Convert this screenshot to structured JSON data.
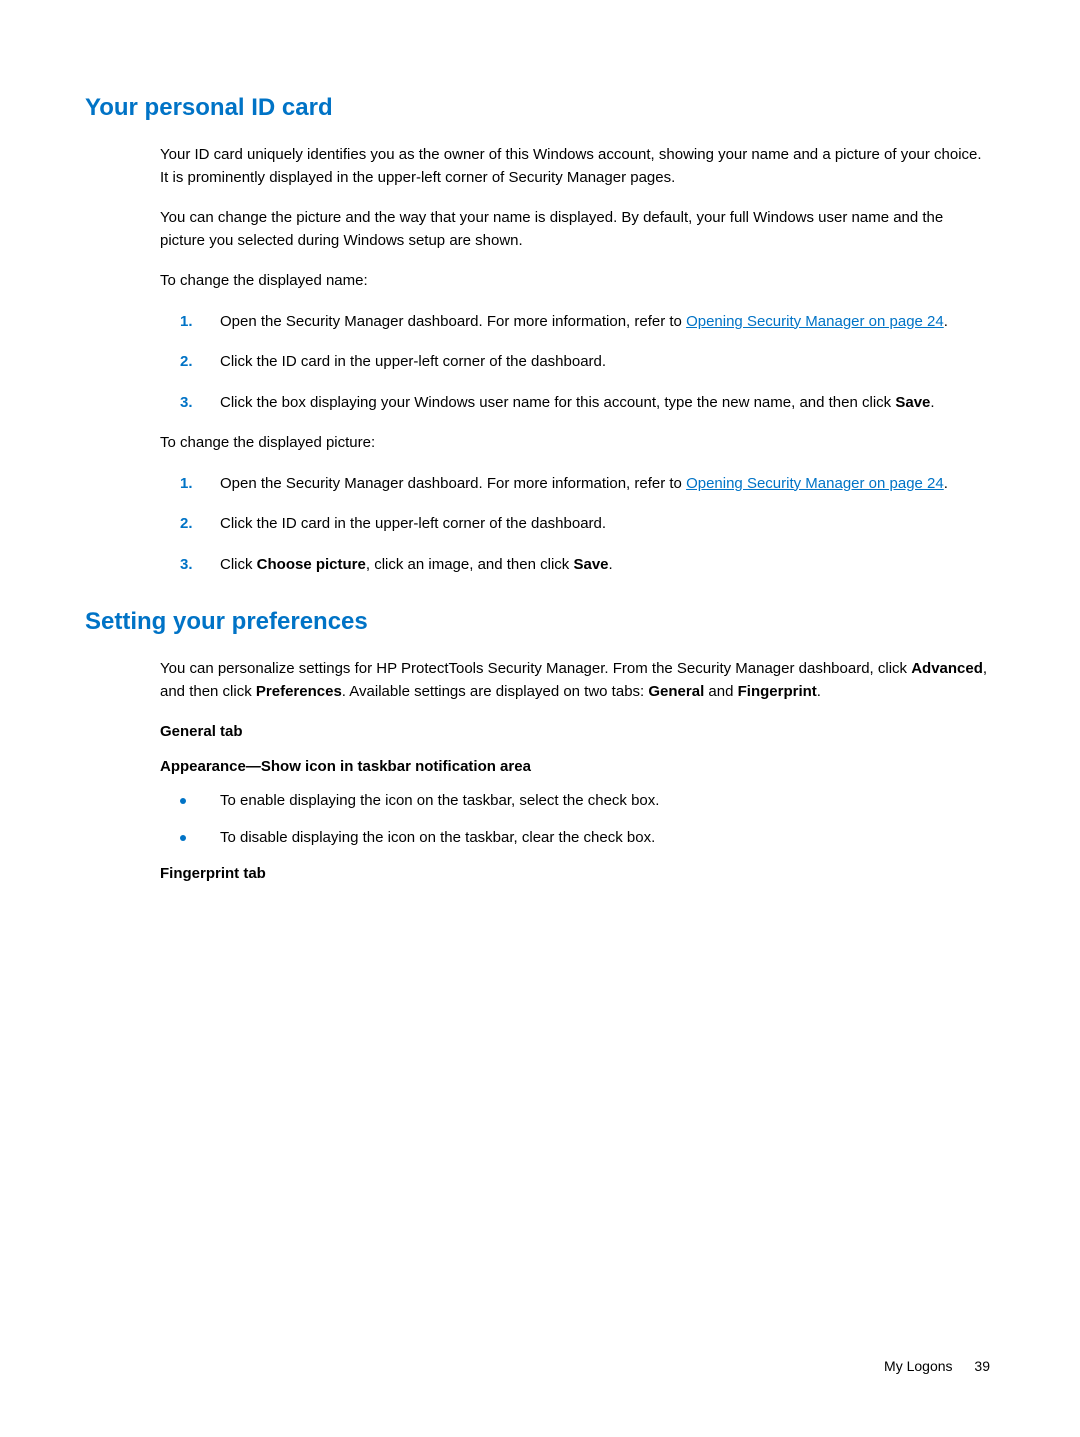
{
  "section1": {
    "heading": "Your personal ID card",
    "para1": "Your ID card uniquely identifies you as the owner of this Windows account, showing your name and a picture of your choice. It is prominently displayed in the upper-left corner of Security Manager pages.",
    "para2": "You can change the picture and the way that your name is displayed. By default, your full Windows user name and the picture you selected during Windows setup are shown.",
    "para3": "To change the displayed name:",
    "list1": {
      "item1_pre": "Open the Security Manager dashboard. For more information, refer to ",
      "item1_link": "Opening Security Manager on page 24",
      "item1_post": ".",
      "item2": "Click the ID card in the upper-left corner of the dashboard.",
      "item3_pre": "Click the box displaying your Windows user name for this account, type the new name, and then click ",
      "item3_bold": "Save",
      "item3_post": "."
    },
    "para4": "To change the displayed picture:",
    "list2": {
      "item1_pre": "Open the Security Manager dashboard. For more information, refer to ",
      "item1_link": "Opening Security Manager on page 24",
      "item1_post": ".",
      "item2": "Click the ID card in the upper-left corner of the dashboard.",
      "item3_pre": "Click ",
      "item3_bold1": "Choose picture",
      "item3_mid": ", click an image, and then click ",
      "item3_bold2": "Save",
      "item3_post": "."
    }
  },
  "section2": {
    "heading": "Setting your preferences",
    "para1_pre": "You can personalize settings for HP ProtectTools Security Manager. From the Security Manager dashboard, click ",
    "para1_bold1": "Advanced",
    "para1_mid1": ", and then click ",
    "para1_bold2": "Preferences",
    "para1_mid2": ". Available settings are displayed on two tabs: ",
    "para1_bold3": "General",
    "para1_mid3": " and ",
    "para1_bold4": "Fingerprint",
    "para1_post": ".",
    "sub1": "General tab",
    "sub2_bold1": "Appearance",
    "sub2_dash": "—",
    "sub2_bold2": "Show icon in taskbar notification area",
    "bullets": {
      "b1": "To enable displaying the icon on the taskbar, select the check box.",
      "b2": "To disable displaying the icon on the taskbar, clear the check box."
    },
    "sub3": "Fingerprint tab"
  },
  "footer": {
    "text": "My Logons",
    "page": "39"
  },
  "nums": {
    "n1": "1.",
    "n2": "2.",
    "n3": "3."
  }
}
